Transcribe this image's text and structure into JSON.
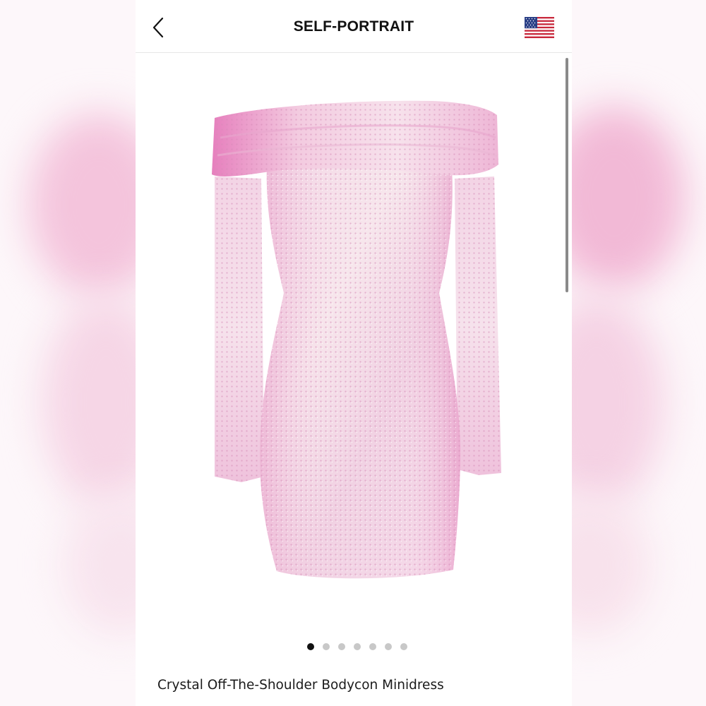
{
  "header": {
    "brand": "SELF-PORTRAIT",
    "back_icon": "chevron-left-icon",
    "region_icon": "us-flag-icon"
  },
  "product": {
    "title": "Crystal Off-The-Shoulder Bodycon Minidress",
    "image": "pink crystal off-the-shoulder minidress",
    "colors": {
      "pink": "#e98ac4",
      "light_pink": "#f6d3e6",
      "cream": "#f7efe9"
    }
  },
  "gallery": {
    "total_images": 7,
    "active_index": 0
  },
  "colors": {
    "text": "#111111",
    "divider": "#e6e6e6",
    "dot_inactive": "#c8c8c8",
    "dot_active": "#111111"
  }
}
